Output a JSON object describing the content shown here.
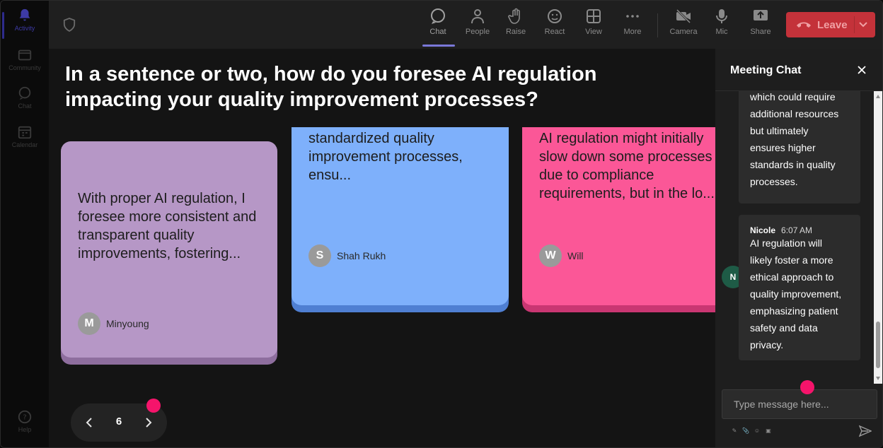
{
  "rail": {
    "items": [
      {
        "label": "Activity",
        "icon": "bell-icon",
        "active": true
      },
      {
        "label": "Community",
        "icon": "community-icon"
      },
      {
        "label": "Chat",
        "icon": "chat-icon"
      },
      {
        "label": "Calendar",
        "icon": "calendar-icon"
      },
      {
        "label": "Help",
        "icon": "help-icon"
      }
    ]
  },
  "toolbar": {
    "buttons": [
      {
        "label": "Chat",
        "icon": "chat-bubble-icon"
      },
      {
        "label": "People",
        "icon": "people-icon"
      },
      {
        "label": "Raise",
        "icon": "raise-hand-icon"
      },
      {
        "label": "React",
        "icon": "emoji-icon"
      },
      {
        "label": "View",
        "icon": "grid-view-icon"
      },
      {
        "label": "More",
        "icon": "more-icon"
      },
      {
        "label": "Camera",
        "icon": "camera-off-icon"
      },
      {
        "label": "Mic",
        "icon": "mic-icon"
      },
      {
        "label": "Share",
        "icon": "share-icon"
      }
    ],
    "leave_label": "Leave"
  },
  "stage": {
    "question": "In a sentence or two, how do you foresee AI regulation impacting your quality improvement processes?",
    "cards": [
      {
        "text": "With proper AI regulation, I foresee more consistent and transparent quality improvements, fostering...",
        "author": "Minyoung",
        "initial": "M",
        "color": "#b697c6"
      },
      {
        "text": "standardized quality improvement processes, ensu...",
        "author": "Shah Rukh",
        "initial": "S",
        "color": "#7eb0fb"
      },
      {
        "text": "AI regulation might initially slow down some processes due to compliance requirements, but in the lo...",
        "author": "Will",
        "initial": "W",
        "color": "#fb5797"
      }
    ],
    "pager": {
      "page": "6"
    }
  },
  "chat": {
    "title": "Meeting Chat",
    "messages": [
      {
        "text_lines": [
          "which could require",
          "additional resources",
          "but ultimately",
          "ensures higher",
          "standards in quality",
          "processes."
        ]
      },
      {
        "author": "Nicole",
        "initial": "N",
        "time": "6:07 AM",
        "text_lines": [
          "AI regulation will",
          "likely foster a more",
          "ethical approach to",
          "quality improvement,",
          "emphasizing patient",
          "safety and data",
          "privacy."
        ]
      }
    ],
    "input_placeholder": "Type message here..."
  },
  "colors": {
    "accent": "#f5146b",
    "leave": "#c4323a",
    "chat_avatar": "#1e5b46"
  }
}
